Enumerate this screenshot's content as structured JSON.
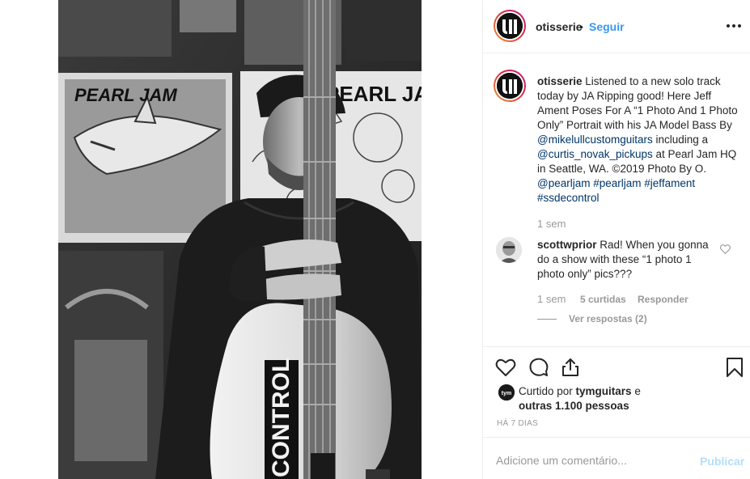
{
  "post": {
    "username": "otisserie",
    "follow_label": "Seguir",
    "separator": "•"
  },
  "caption": {
    "username": "otisserie",
    "text_1": " Listened to a new solo track today by JA Ripping good! Here Jeff Ament Poses For A “1 Photo And 1 Photo Only” Portrait with his JA Model Bass By ",
    "mention_1": "@mikelullcustomguitars",
    "text_2": " including a ",
    "mention_2": "@curtis_novak_pickups",
    "text_3": " at Pearl Jam HQ in Seattle, WA. ©2019 Photo By O. ",
    "mention_3": "@pearljam",
    "hashtag_1": "#pearljam",
    "hashtag_2": "#jeffament",
    "hashtag_3": "#ssdecontrol",
    "time": "1 sem"
  },
  "comment": {
    "username": "scottwprior",
    "text": " Rad! When you gonna do a show with these “1 photo 1 photo only” pics???",
    "time": "1 sem",
    "likes": "5 curtidas",
    "reply_label": "Responder",
    "view_replies": "Ver respostas (2)"
  },
  "likes": {
    "prefix": "Curtido por ",
    "user": "tymguitars",
    "mid": " e ",
    "others": "outras 1.100 pessoas",
    "avatar_text": "tym"
  },
  "post_time": "HÁ 7 DIAS",
  "comment_form": {
    "placeholder": "Adicione um comentário...",
    "publish_label": "Publicar"
  },
  "image": {
    "poster_1_text": "PEARL JAM",
    "poster_2_text": "PEARL JAM",
    "guitar_sticker": "CONTROL"
  },
  "colors": {
    "link": "#003569",
    "follow": "#3897f0",
    "publish_disabled": "#b2dffc",
    "muted": "#999999"
  },
  "icons": [
    "more-options-icon",
    "heart-icon",
    "comment-icon",
    "share-icon",
    "bookmark-icon",
    "heart-small-icon"
  ]
}
